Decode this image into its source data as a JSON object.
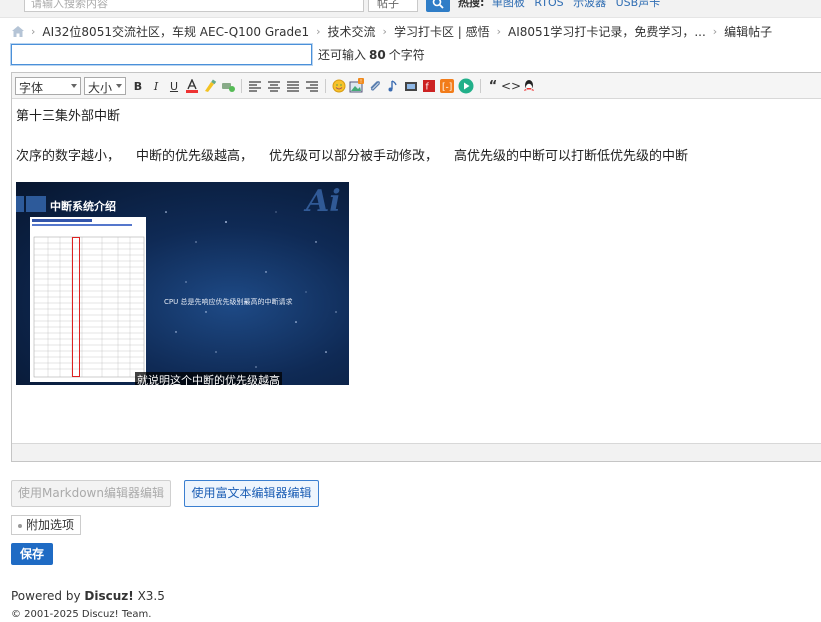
{
  "topbar": {
    "search_placeholder": "请输入搜索内容",
    "search_type": "帖子",
    "hot_label": "热搜:",
    "hot_items": [
      "单图板",
      "RTOS",
      "示波器",
      "USB声卡"
    ]
  },
  "breadcrumb": {
    "items": [
      "AI32位8051交流社区，车规 AEC-Q100 Grade1",
      "技术交流",
      "学习打卡区 | 感悟",
      "AI8051学习打卡记录，免费学习，...",
      "编辑帖子"
    ]
  },
  "subject": {
    "value": "",
    "counter_prefix": "还可输入",
    "counter_value": "80",
    "counter_suffix": "个字符"
  },
  "toolbar": {
    "font_label": "字体",
    "size_label": "大小",
    "icons": [
      "bold-icon",
      "italic-icon",
      "underline-icon",
      "font-color-icon",
      "highlight-icon",
      "link-icon",
      "align-left-icon",
      "align-center-icon",
      "align-justify-icon",
      "align-right-icon",
      "smiley-icon",
      "image-icon",
      "attachment-icon",
      "music-icon",
      "video-icon",
      "flash-icon",
      "code-bracket-icon",
      "play-icon",
      "quote-icon",
      "code-icon",
      "qq-icon"
    ]
  },
  "content": {
    "paragraph_1": "第十三集外部中断",
    "paragraph_2_parts": [
      "次序的数字越小，",
      "中断的优先级越高，",
      "优先级可以部分被手动修改，",
      "高优先级的中断可以打断低优先级的中断"
    ],
    "video": {
      "title": "中断系统介绍",
      "brand": "Ai",
      "message": "CPU 总是先响应优先级别最高的中断请求",
      "subtitle": "就说明这个中断的优先级越高"
    }
  },
  "buttons": {
    "markdown": "使用Markdown编辑器编辑",
    "richtext": "使用富文本编辑器编辑",
    "extra": "附加选项",
    "save": "保存"
  },
  "footer": {
    "powered_prefix": "Powered by",
    "powered_brand": "Discuz!",
    "powered_version": "X3.5",
    "copyright": "© 2001-2025 Discuz! Team."
  },
  "colors": {
    "accent": "#1f6bc4",
    "link": "#2f6db3",
    "input_focus": "#4a90d9"
  }
}
